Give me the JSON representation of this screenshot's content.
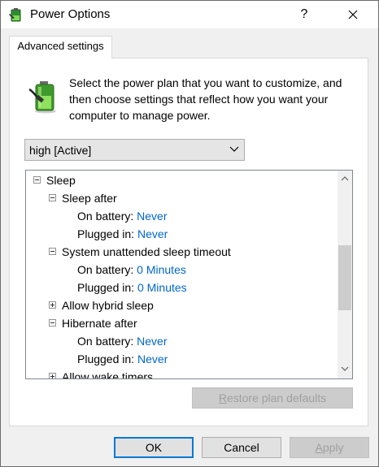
{
  "window": {
    "title": "Power Options",
    "help_label": "?",
    "close_label": "✕"
  },
  "tab": {
    "label": "Advanced settings"
  },
  "description": "Select the power plan that you want to customize, and then choose settings that reflect how you want your computer to manage power.",
  "plan": {
    "selected": "high [Active]"
  },
  "tree": {
    "sleep": "Sleep",
    "sleep_after": "Sleep after",
    "sleep_after_battery_label": "On battery:",
    "sleep_after_battery_value": "Never",
    "sleep_after_plugged_label": "Plugged in:",
    "sleep_after_plugged_value": "Never",
    "unattended": "System unattended sleep timeout",
    "unattended_battery_label": "On battery:",
    "unattended_battery_value": "0 Minutes",
    "unattended_plugged_label": "Plugged in:",
    "unattended_plugged_value": "0 Minutes",
    "hybrid": "Allow hybrid sleep",
    "hibernate": "Hibernate after",
    "hibernate_battery_label": "On battery:",
    "hibernate_battery_value": "Never",
    "hibernate_plugged_label": "Plugged in:",
    "hibernate_plugged_value": "Never",
    "wake_timers": "Allow wake timers"
  },
  "buttons": {
    "restore_first": "R",
    "restore_rest": "estore plan defaults",
    "ok": "OK",
    "cancel": "Cancel",
    "apply_first": "A",
    "apply_rest": "pply"
  },
  "colors": {
    "link": "#0066cc",
    "focus": "#0078d7"
  }
}
